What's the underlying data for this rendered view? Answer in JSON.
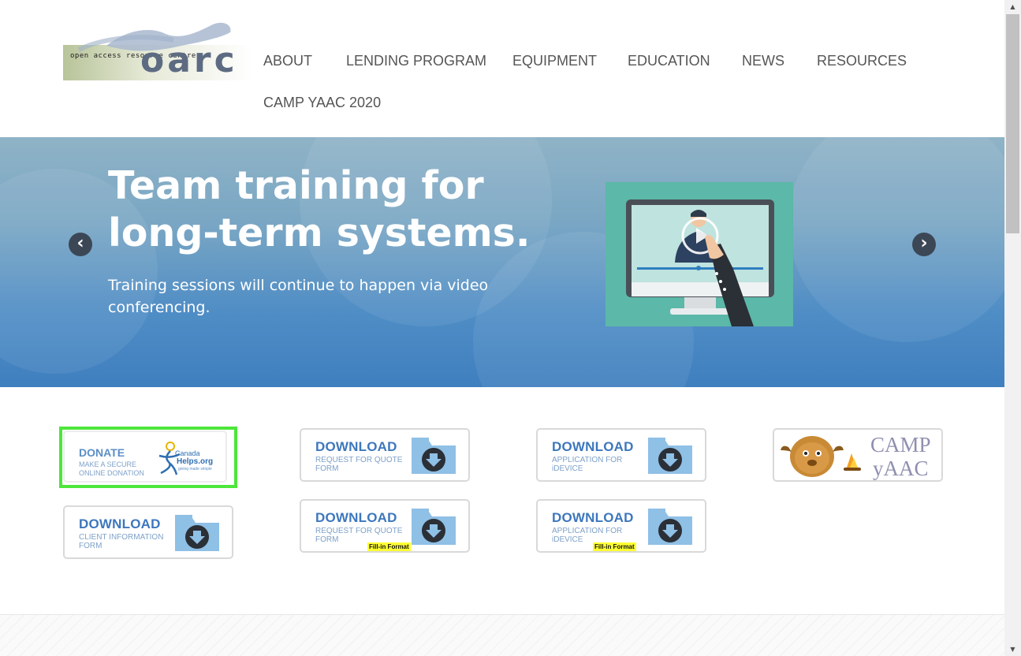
{
  "logo": {
    "tagline": "open access resource centre",
    "wordmark": "oarc"
  },
  "nav": {
    "items": [
      {
        "label": "ABOUT"
      },
      {
        "label": "LENDING PROGRAM"
      },
      {
        "label": "EQUIPMENT"
      },
      {
        "label": "EDUCATION"
      },
      {
        "label": "NEWS"
      },
      {
        "label": "RESOURCES"
      },
      {
        "label": "CAMP YAAC 2020"
      }
    ]
  },
  "slider": {
    "title_line1": "Team training for",
    "title_line2": "long-term systems.",
    "subtitle": "Training sessions will continue to happen via video conferencing.",
    "prev_icon": "‹",
    "next_icon": "›"
  },
  "buttons": {
    "donate": {
      "title": "DONATE",
      "sub": "MAKE A SECURE ONLINE DONATION",
      "brand_line1": "Canada",
      "brand_line2": "Helps.org",
      "brand_tag": "giving made simple"
    },
    "download_quote": {
      "title": "DOWNLOAD",
      "sub": "REQUEST FOR QUOTE FORM"
    },
    "download_idevice": {
      "title": "DOWNLOAD",
      "sub": "APPLICATION FOR iDEVICE"
    },
    "camp": {
      "line1": "CAMP",
      "line2": "yAAC"
    },
    "download_client": {
      "title": "DOWNLOAD",
      "sub": "CLIENT INFORMATION FORM"
    },
    "download_quote_fill": {
      "title": "DOWNLOAD",
      "sub": "REQUEST FOR QUOTE FORM",
      "badge": "Fill-in Format"
    },
    "download_idevice_fill": {
      "title": "DOWNLOAD",
      "sub": "APPLICATION FOR iDEVICE",
      "badge": "Fill-in Format"
    }
  },
  "colors": {
    "accent_blue": "#3d77bd",
    "highlight_green": "#4de63a",
    "badge_yellow": "#ffff33",
    "folder_blue": "#8fc0e6",
    "slider_bottom": "#3f7fbf"
  },
  "icons": {
    "download": "download-arrow-icon",
    "prev": "chevron-left-icon",
    "next": "chevron-right-icon"
  }
}
